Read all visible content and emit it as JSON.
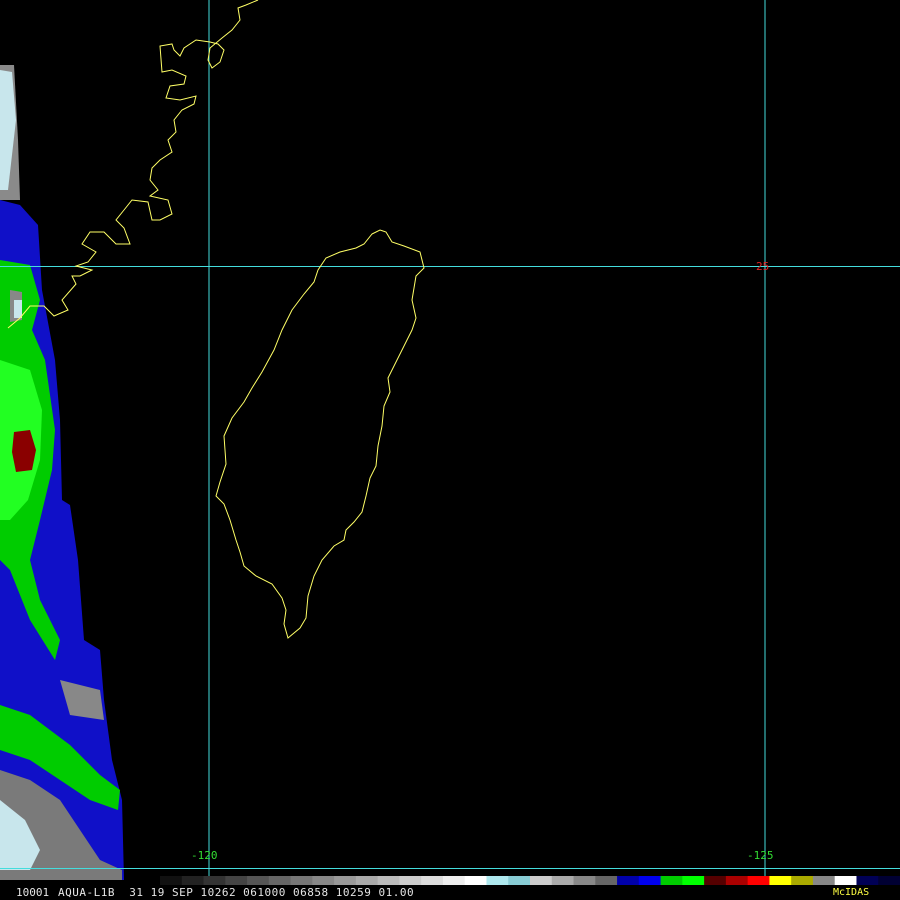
{
  "status_bar": {
    "frame": "10001",
    "text": "AQUA-L1B  31 19 SEP 10262 061000 06858 10259 01.00",
    "brand": "McIDAS"
  },
  "grid": {
    "lon_labels": [
      "-120",
      "-125"
    ],
    "lat_labels": [
      "25"
    ]
  },
  "colors": {
    "grid": "#44dddd",
    "coast": "#ffff66",
    "lon_label": "#33dd33",
    "lat_label": "#dd2222"
  },
  "color_table": [
    "#111",
    "#222",
    "#333",
    "#444",
    "#555",
    "#666",
    "#777",
    "#888",
    "#999",
    "#aaa",
    "#bbb",
    "#ccc",
    "#ddd",
    "#eee",
    "#ffffff",
    "#aee8ee",
    "#88ccd4",
    "#ccc",
    "#aaa",
    "#888",
    "#666",
    "#0000aa",
    "#0000ee",
    "#00cc00",
    "#00ff00",
    "#550000",
    "#aa0000",
    "#ff0000",
    "#ffff00",
    "#aaaa00",
    "#888888",
    "#ffffff",
    "#000055",
    "#000033"
  ]
}
